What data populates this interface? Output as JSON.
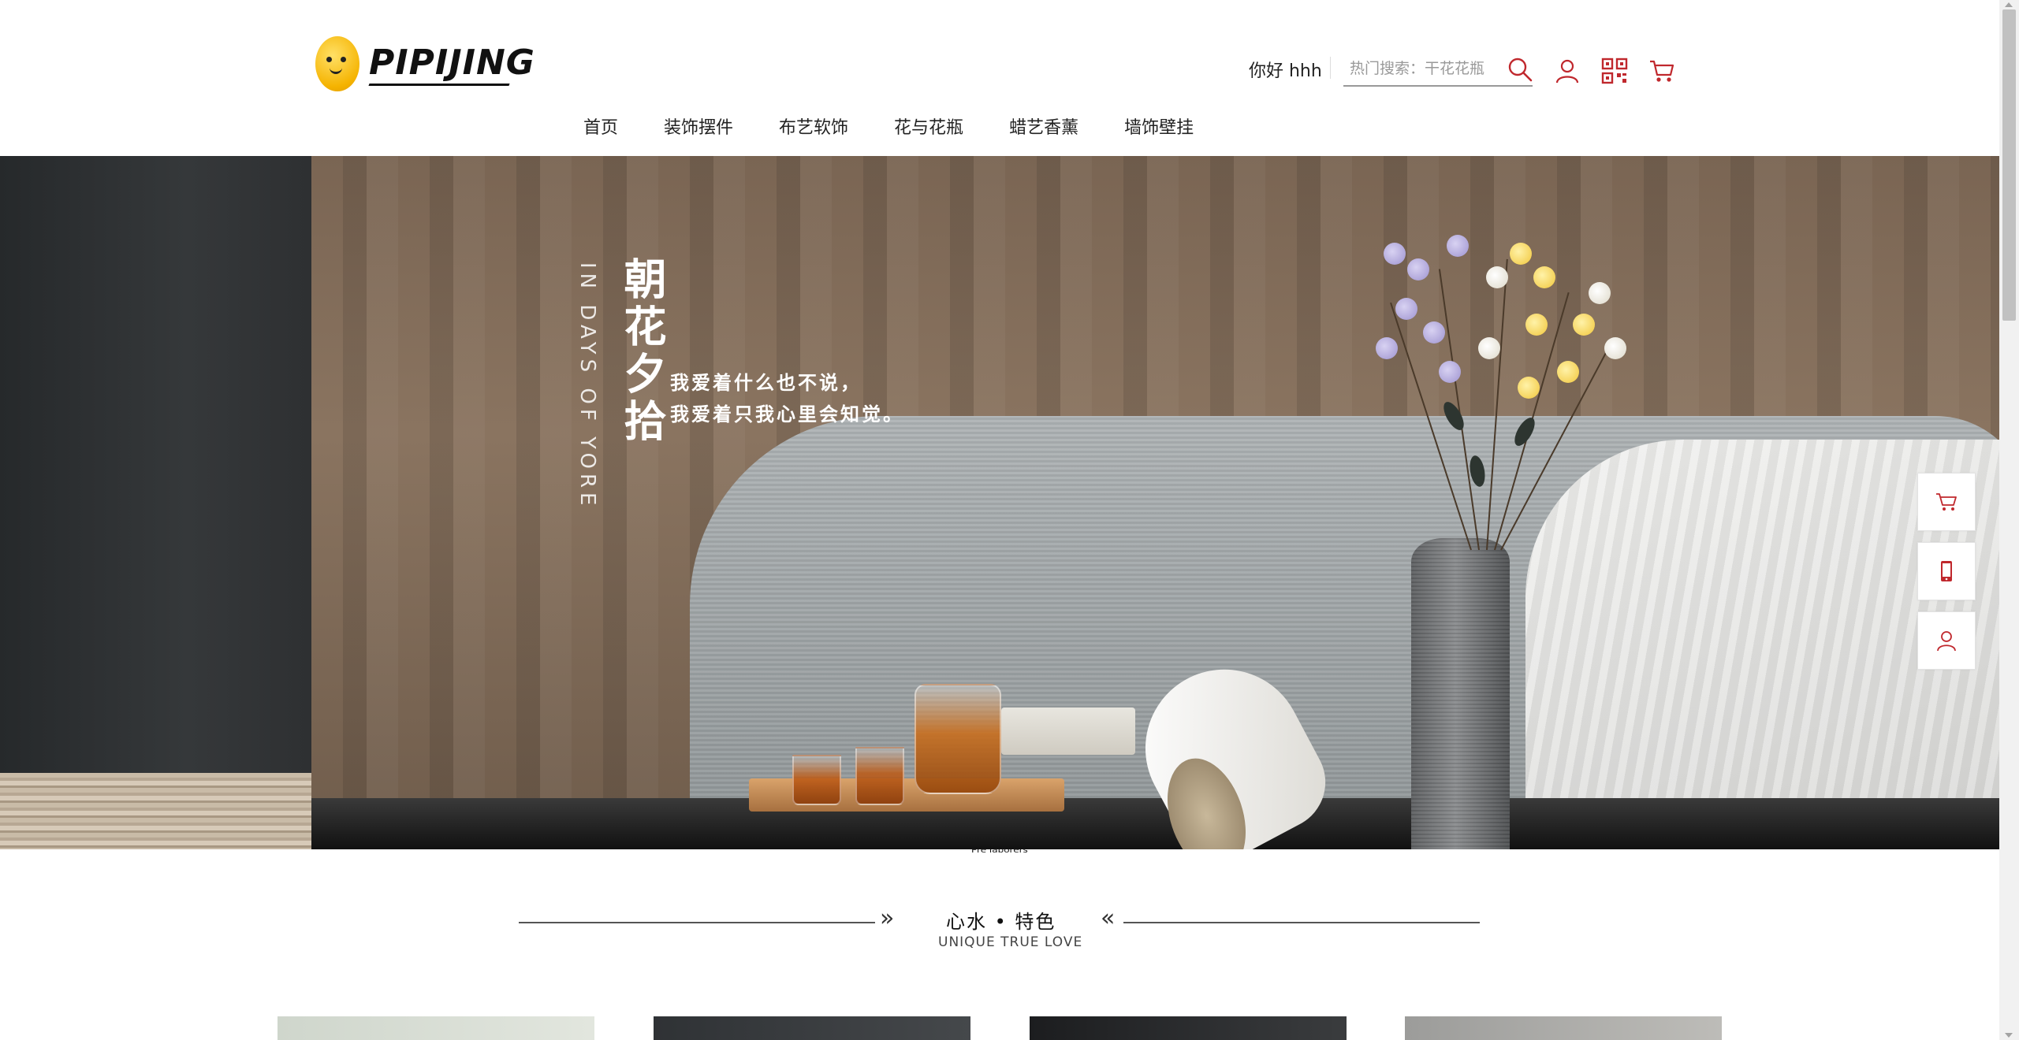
{
  "header": {
    "logo_text": "PIPIJING",
    "greeting": "你好 hhh",
    "search_placeholder": "热门搜索：干花花瓶",
    "accent_color": "#c0282d"
  },
  "nav": {
    "items": [
      {
        "label": "首页"
      },
      {
        "label": "装饰摆件"
      },
      {
        "label": "布艺软饰"
      },
      {
        "label": "花与花瓶"
      },
      {
        "label": "蜡艺香薰"
      },
      {
        "label": "墙饰壁挂"
      }
    ]
  },
  "banner": {
    "title_cn": "朝花夕拾",
    "title_en": "IN DAYS OF YORE",
    "line1": "我爱着什么也不说，",
    "line2": "我爱着只我心里会知觉。",
    "caption": "Pre laborers"
  },
  "float_bar": {
    "icons": [
      "cart-icon",
      "mobile-icon",
      "user-icon"
    ]
  },
  "section": {
    "title_cn": "心水 • 特色",
    "title_en": "UNIQUE TRUE LOVE",
    "chevron_left": "»",
    "chevron_right": "«"
  },
  "products": {
    "count_visible": 4
  }
}
